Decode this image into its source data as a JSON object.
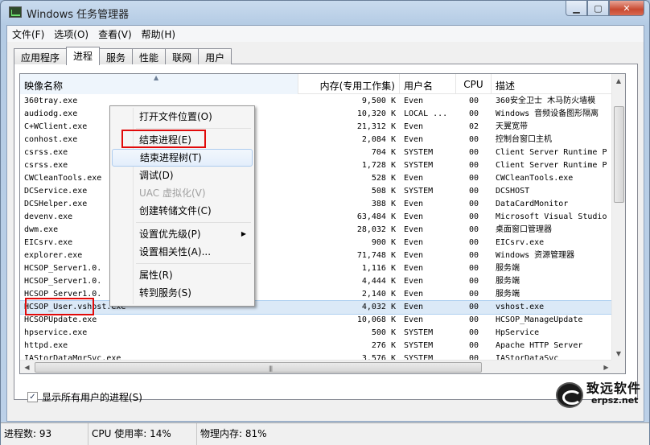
{
  "window": {
    "title": "Windows 任务管理器",
    "min_glyph": "▁",
    "max_glyph": "▢",
    "close_glyph": "✕"
  },
  "menubar": [
    "文件(F)",
    "选项(O)",
    "查看(V)",
    "帮助(H)"
  ],
  "tabs": [
    {
      "label": "应用程序",
      "active": false
    },
    {
      "label": "进程",
      "active": true
    },
    {
      "label": "服务",
      "active": false
    },
    {
      "label": "性能",
      "active": false
    },
    {
      "label": "联网",
      "active": false
    },
    {
      "label": "用户",
      "active": false
    }
  ],
  "columns": {
    "name": "映像名称",
    "mem": "内存(专用工作集)",
    "user": "用户名",
    "cpu": "CPU",
    "desc": "描述"
  },
  "processes": [
    {
      "name": "360tray.exe",
      "mem": "9,500 K",
      "user": "Even",
      "cpu": "00",
      "desc": "360安全卫士 木马防火墙模"
    },
    {
      "name": "audiodg.exe",
      "mem": "10,320 K",
      "user": "LOCAL ...",
      "cpu": "00",
      "desc": "Windows 音频设备图形隔离"
    },
    {
      "name": "C+WClient.exe",
      "mem": "21,312 K",
      "user": "Even",
      "cpu": "02",
      "desc": "天翼宽带"
    },
    {
      "name": "conhost.exe",
      "mem": "2,084 K",
      "user": "Even",
      "cpu": "00",
      "desc": "控制台窗口主机"
    },
    {
      "name": "csrss.exe",
      "mem": "704 K",
      "user": "SYSTEM",
      "cpu": "00",
      "desc": "Client Server Runtime P"
    },
    {
      "name": "csrss.exe",
      "mem": "1,728 K",
      "user": "SYSTEM",
      "cpu": "00",
      "desc": "Client Server Runtime P"
    },
    {
      "name": "CWCleanTools.exe",
      "mem": "528 K",
      "user": "Even",
      "cpu": "00",
      "desc": "CWCleanTools.exe"
    },
    {
      "name": "DCService.exe",
      "mem": "508 K",
      "user": "SYSTEM",
      "cpu": "00",
      "desc": "DCSHOST"
    },
    {
      "name": "DCSHelper.exe",
      "mem": "388 K",
      "user": "Even",
      "cpu": "00",
      "desc": "DataCardMonitor"
    },
    {
      "name": "devenv.exe",
      "mem": "63,484 K",
      "user": "Even",
      "cpu": "00",
      "desc": "Microsoft Visual Studio"
    },
    {
      "name": "dwm.exe",
      "mem": "28,032 K",
      "user": "Even",
      "cpu": "00",
      "desc": "桌面窗口管理器"
    },
    {
      "name": "EICsrv.exe",
      "mem": "900 K",
      "user": "Even",
      "cpu": "00",
      "desc": "EICsrv.exe"
    },
    {
      "name": "explorer.exe",
      "mem": "71,748 K",
      "user": "Even",
      "cpu": "00",
      "desc": "Windows 资源管理器"
    },
    {
      "name": "HCSOP_Server1.0.",
      "mem": "1,116 K",
      "user": "Even",
      "cpu": "00",
      "desc": "服务端"
    },
    {
      "name": "HCSOP_Server1.0.",
      "mem": "4,444 K",
      "user": "Even",
      "cpu": "00",
      "desc": "服务端"
    },
    {
      "name": "HCSOP_Server1.0.",
      "mem": "2,140 K",
      "user": "Even",
      "cpu": "00",
      "desc": "服务端"
    },
    {
      "name": "HCSOP_User.vshost.exe",
      "mem": "4,032 K",
      "user": "Even",
      "cpu": "00",
      "desc": "vshost.exe",
      "selected": true
    },
    {
      "name": "HCSOPUpdate.exe",
      "mem": "10,068 K",
      "user": "Even",
      "cpu": "00",
      "desc": "HCSOP_ManageUpdate"
    },
    {
      "name": "hpservice.exe",
      "mem": "500 K",
      "user": "SYSTEM",
      "cpu": "00",
      "desc": "HpService"
    },
    {
      "name": "httpd.exe",
      "mem": "276 K",
      "user": "SYSTEM",
      "cpu": "00",
      "desc": "Apache HTTP Server"
    },
    {
      "name": "IAStorDataMgrSvc.exe",
      "mem": "3,576 K",
      "user": "SYSTEM",
      "cpu": "00",
      "desc": "IAStorDataSvc"
    }
  ],
  "context_menu": [
    {
      "label": "打开文件位置(O)"
    },
    {
      "sep": true
    },
    {
      "label": "结束进程(E)"
    },
    {
      "label": "结束进程树(T)",
      "hover": true
    },
    {
      "label": "调试(D)"
    },
    {
      "label": "UAC 虚拟化(V)",
      "disabled": true
    },
    {
      "label": "创建转储文件(C)"
    },
    {
      "sep": true
    },
    {
      "label": "设置优先级(P)",
      "submenu": true
    },
    {
      "label": "设置相关性(A)..."
    },
    {
      "sep": true
    },
    {
      "label": "属性(R)"
    },
    {
      "label": "转到服务(S)"
    }
  ],
  "show_all_users": {
    "label": "显示所有用户的进程(S)",
    "checked": true,
    "check_glyph": "✓"
  },
  "status": {
    "processes": "进程数: 93",
    "cpu": "CPU 使用率: 14%",
    "memory": "物理内存: 81%"
  },
  "watermark": {
    "text": "致远软件",
    "url": "erpsz.net"
  },
  "colors": {
    "highlight_box": "#e10a0a",
    "selection": "#dbe9f7"
  }
}
